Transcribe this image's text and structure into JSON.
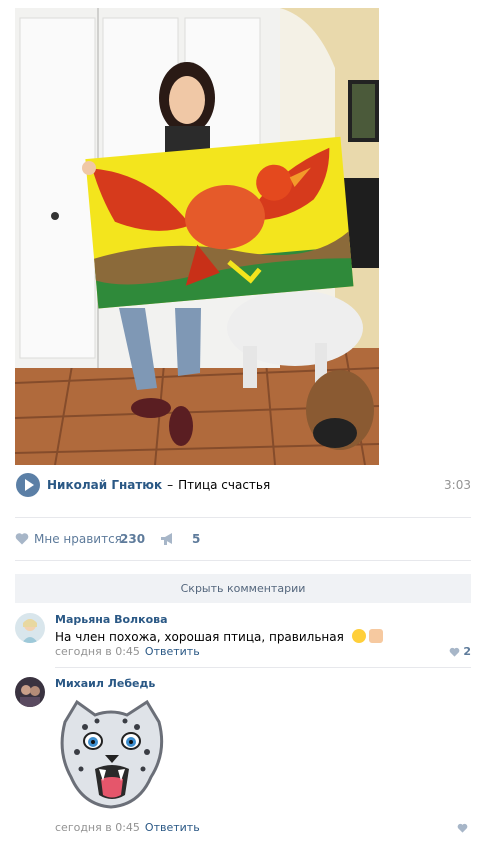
{
  "audio": {
    "artist": "Николай Гнатюк",
    "separator": "–",
    "title": "Птица счастья",
    "duration": "3:03",
    "play_icon": "play-icon"
  },
  "likes": {
    "like_label": "Мне нравится",
    "like_count": "230",
    "share_count": "5",
    "like_icon": "heart-icon",
    "share_icon": "megaphone-icon"
  },
  "comments_toggle": {
    "label": "Скрыть комментарии"
  },
  "comments": [
    {
      "author": "Марьяна Волкова",
      "text": "На член похожа, хорошая птица, правильная",
      "emojis": [
        "wink-tongue-emoji",
        "thumbs-up-emoji"
      ],
      "time": "сегодня в 0:45",
      "reply": "Ответить",
      "likes": "2"
    },
    {
      "author": "Михаил Лебедь",
      "sticker": "snow-leopard-sticker",
      "time": "сегодня в 0:45",
      "reply": "Ответить",
      "likes": ""
    }
  ],
  "colors": {
    "link": "#2a5885",
    "meta": "#939393",
    "accent": "#5e7b9b",
    "divider": "#e7e8ec"
  }
}
